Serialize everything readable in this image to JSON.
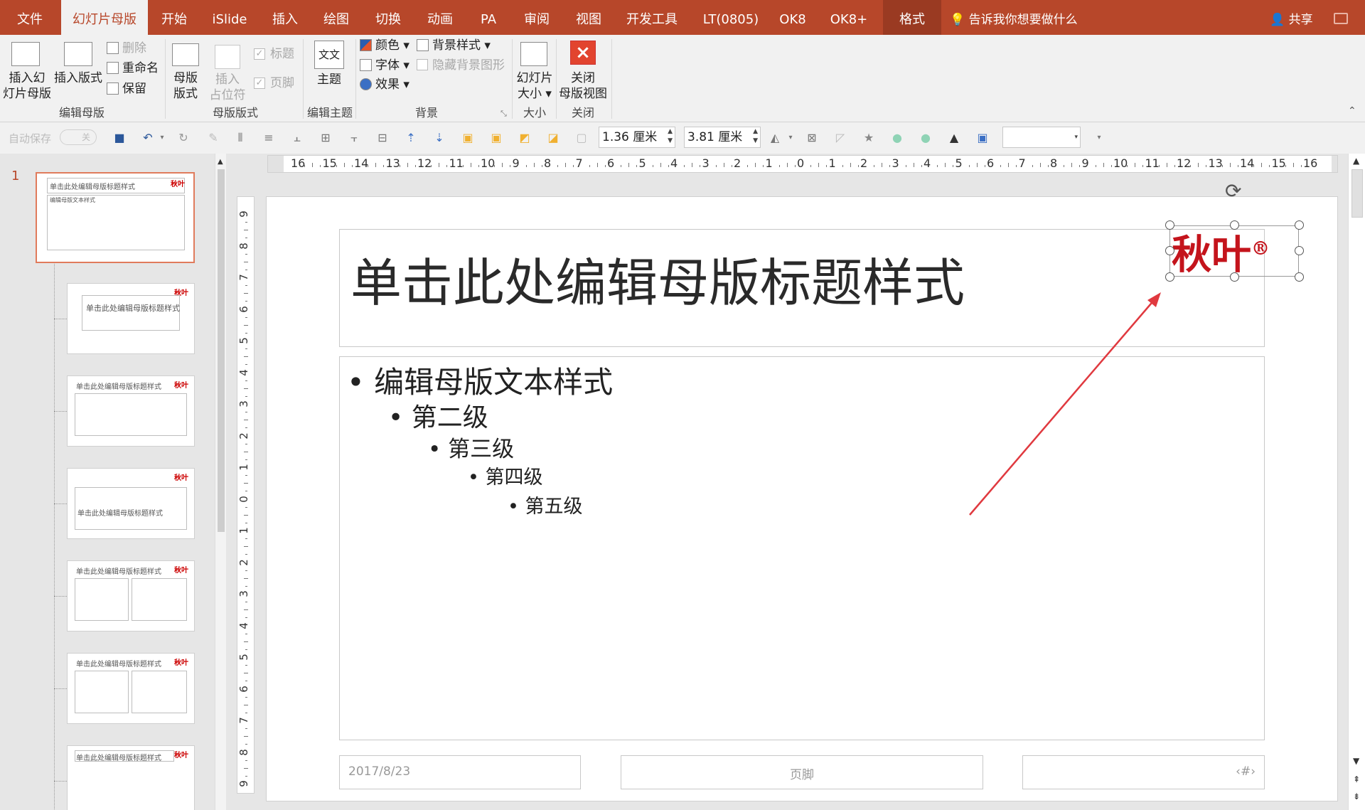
{
  "tabs": [
    "文件",
    "幻灯片母版",
    "开始",
    "iSlide",
    "插入",
    "绘图",
    "切换",
    "动画",
    "PA",
    "审阅",
    "视图",
    "开发工具",
    "LT(0805)",
    "OK8",
    "OK8+",
    "格式"
  ],
  "active_tab": "幻灯片母版",
  "tell_me": "告诉我你想要做什么",
  "share": "共享",
  "ribbon": {
    "insert_master": [
      "插入幻",
      "灯片母版"
    ],
    "insert_layout": "插入版式",
    "delete": "删除",
    "rename": "重命名",
    "preserve": "保留",
    "group_edit_master": "编辑母版",
    "master_layout": [
      "母版",
      "版式"
    ],
    "insert_placeholder": [
      "插入",
      "占位符"
    ],
    "title_chk": "标题",
    "footer_chk": "页脚",
    "group_master_layout": "母版版式",
    "theme": "主题",
    "theme_icon_text": "文文",
    "group_edit_theme": "编辑主题",
    "colors": "颜色",
    "fonts": "字体",
    "effects": "效果",
    "bg_styles": "背景样式",
    "hide_bg": "隐藏背景图形",
    "group_background": "背景",
    "slide_size": [
      "幻灯片",
      "大小"
    ],
    "group_size": "大小",
    "close_view": [
      "关闭",
      "母版视图"
    ],
    "group_close": "关闭"
  },
  "qat": {
    "autosave": "自动保存",
    "autosave_state": "关",
    "height": "1.36 厘米",
    "width": "3.81 厘米"
  },
  "thumbs": {
    "slide_number": "1",
    "title_text": "单击此处编辑母版标题样式",
    "body_text": "编辑母版文本样式",
    "logo": "秋叶"
  },
  "ruler": {
    "h": [
      "16",
      "15",
      "14",
      "13",
      "12",
      "11",
      "10",
      "9",
      "8",
      "7",
      "6",
      "5",
      "4",
      "3",
      "2",
      "1",
      "0",
      "1",
      "2",
      "3",
      "4",
      "5",
      "6",
      "7",
      "8",
      "9",
      "10",
      "11",
      "12",
      "13",
      "14",
      "15",
      "16"
    ],
    "v": [
      "9",
      "8",
      "7",
      "6",
      "5",
      "4",
      "3",
      "2",
      "1",
      "0",
      "1",
      "2",
      "3",
      "4",
      "5",
      "6",
      "7",
      "8",
      "9"
    ]
  },
  "slide": {
    "title": "单击此处编辑母版标题样式",
    "bullets": [
      "编辑母版文本样式",
      "第二级",
      "第三级",
      "第四级",
      "第五级"
    ],
    "date": "2017/8/23",
    "footer": "页脚",
    "page_num": "‹#›",
    "logo_text": "秋叶",
    "logo_mark": "®"
  },
  "colors": {
    "accent": "#b7472a",
    "logo": "#c4141c",
    "arrow": "#e0393f"
  }
}
